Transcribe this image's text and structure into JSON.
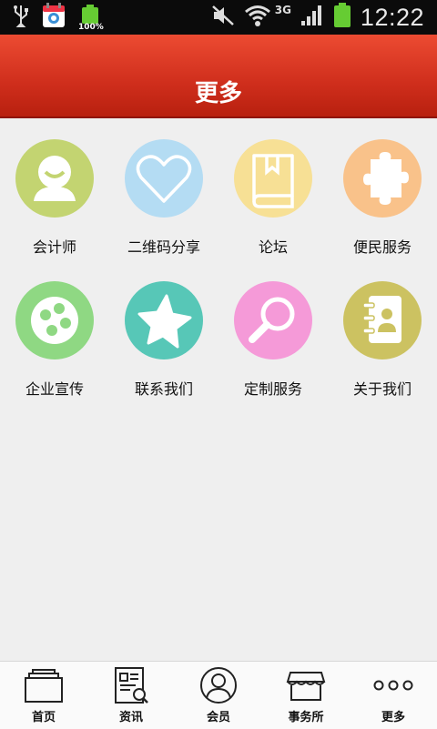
{
  "status_bar": {
    "time": "12:22",
    "network_type": "3G",
    "battery_small_percent": "100%",
    "icons": [
      "usb-icon",
      "app-notification-icon",
      "battery-full-icon",
      "mute-icon",
      "wifi-icon",
      "signal-icon",
      "battery-icon"
    ]
  },
  "header": {
    "title": "更多"
  },
  "grid": {
    "items": [
      {
        "label": "会计师",
        "icon": "accountant-icon",
        "color": "#c3d471"
      },
      {
        "label": "二维码分享",
        "icon": "heart-icon",
        "color": "#b4dcf3"
      },
      {
        "label": "论坛",
        "icon": "book-icon",
        "color": "#f7e095"
      },
      {
        "label": "便民服务",
        "icon": "puzzle-icon",
        "color": "#f9c28a"
      },
      {
        "label": "企业宣传",
        "icon": "dots-icon",
        "color": "#8fd883"
      },
      {
        "label": "联系我们",
        "icon": "star-icon",
        "color": "#57c7b7"
      },
      {
        "label": "定制服务",
        "icon": "magnifier-icon",
        "color": "#f59ad8"
      },
      {
        "label": "关于我们",
        "icon": "contacts-book-icon",
        "color": "#ccc261"
      }
    ]
  },
  "bottom_nav": {
    "items": [
      {
        "label": "首页",
        "icon": "home-icon"
      },
      {
        "label": "资讯",
        "icon": "news-icon"
      },
      {
        "label": "会员",
        "icon": "member-icon"
      },
      {
        "label": "事务所",
        "icon": "shop-icon"
      },
      {
        "label": "更多",
        "icon": "more-icon"
      }
    ]
  }
}
